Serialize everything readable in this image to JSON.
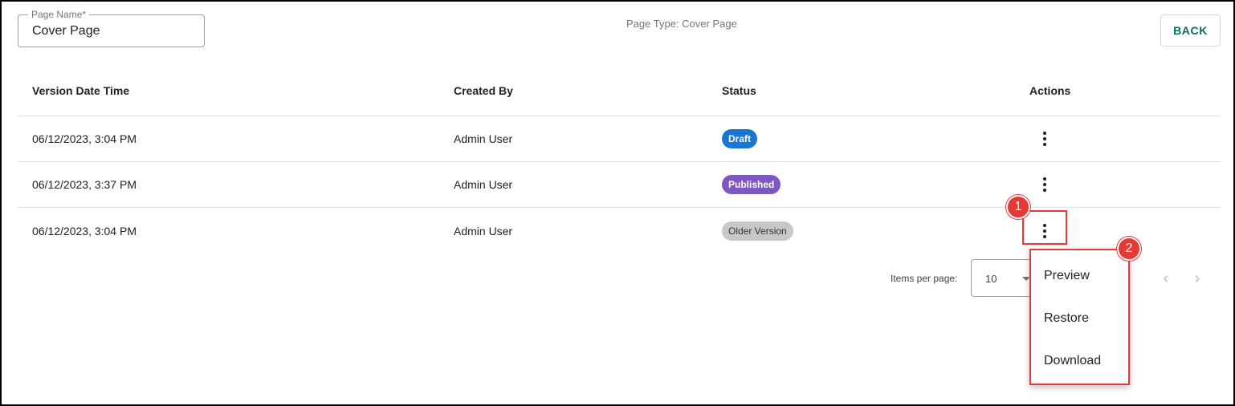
{
  "page_name": {
    "label": "Page Name*",
    "value": "Cover Page"
  },
  "page_type": "Page Type: Cover Page",
  "back_label": "BACK",
  "table": {
    "headers": [
      "Version Date Time",
      "Created By",
      "Status",
      "Actions"
    ],
    "rows": [
      {
        "datetime": "06/12/2023, 3:04 PM",
        "created_by": "Admin User",
        "status": "Draft"
      },
      {
        "datetime": "06/12/2023, 3:37 PM",
        "created_by": "Admin User",
        "status": "Published"
      },
      {
        "datetime": "06/12/2023, 3:04 PM",
        "created_by": "Admin User",
        "status": "Older Version"
      }
    ]
  },
  "paginator": {
    "items_per_page_label": "Items per page:",
    "page_size": "10"
  },
  "actions_menu": {
    "items": [
      "Preview",
      "Restore",
      "Download"
    ]
  },
  "annotations": {
    "marker1": "1",
    "marker2": "2",
    "color": "#e53935"
  },
  "colors": {
    "accent": "#0b6e5a",
    "draft": "#1976d2",
    "published": "#7e57c2",
    "older": "#c8c8c8"
  },
  "icons": {
    "actions": "more-vert-icon",
    "prev": "chevron-left-icon",
    "next": "chevron-right-icon",
    "dropdown": "arrow-drop-down-icon"
  }
}
